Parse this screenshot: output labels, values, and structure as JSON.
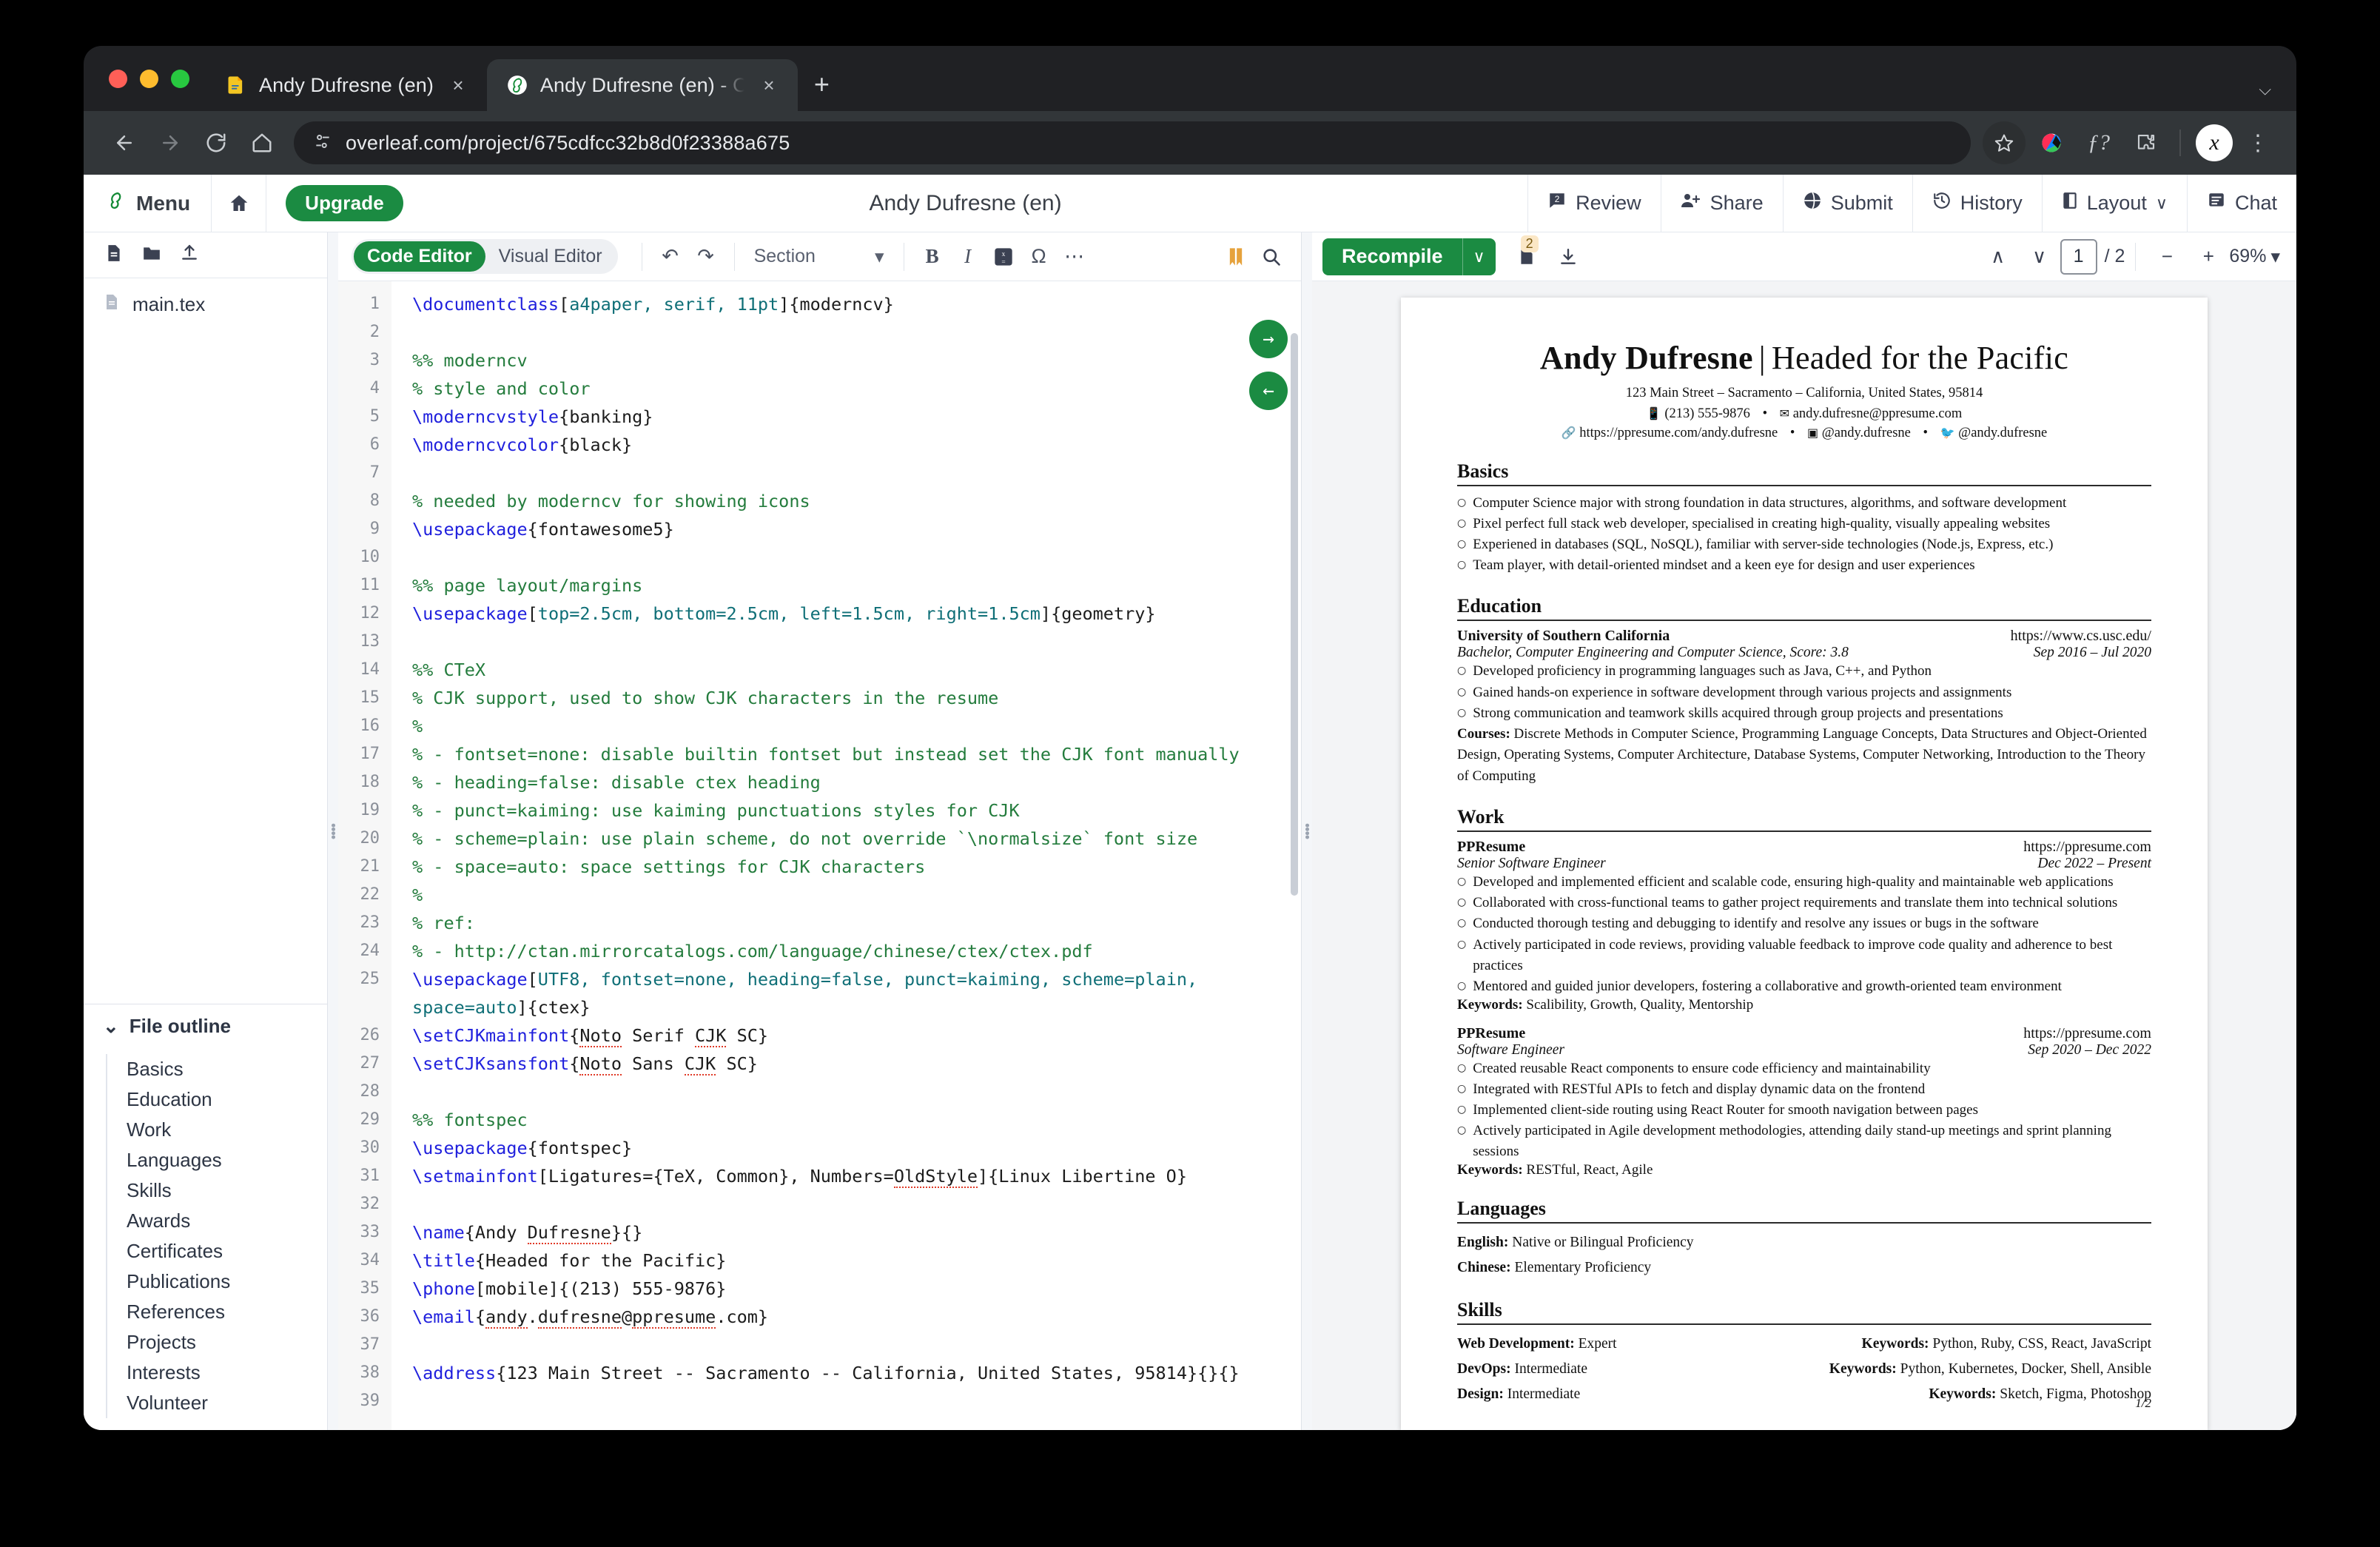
{
  "browser": {
    "tabs": [
      {
        "title": "Andy Dufresne (en)",
        "favicon": "pdf-document-icon",
        "active": false
      },
      {
        "title": "Andy Dufresne (en) - Online L",
        "favicon": "overleaf-icon",
        "active": true
      }
    ],
    "new_tab_label": "+",
    "tabstrip_menu": "⌵",
    "close_label": "×",
    "url": "overleaf.com/project/675cdfcc32b8d0f23388a675",
    "nav": {
      "back": "←",
      "forward": "→",
      "reload": "↻",
      "home": "⌂"
    },
    "extensions": [
      "star-icon",
      "color-palette-icon",
      "font-question-icon",
      "puzzle-extension-icon",
      "profile-avatar-icon"
    ],
    "menu_label": "⋮",
    "avatar_letter": "x"
  },
  "overleaf": {
    "menu_label": "Menu",
    "home_icon": "home-icon",
    "upgrade_label": "Upgrade",
    "project_title": "Andy Dufresne (en)",
    "actions": [
      {
        "label": "Review",
        "icon": "review-comment-icon"
      },
      {
        "label": "Share",
        "icon": "share-person-icon"
      },
      {
        "label": "Submit",
        "icon": "submit-globe-icon"
      },
      {
        "label": "History",
        "icon": "history-clock-icon"
      },
      {
        "label": "Layout",
        "icon": "layout-icon",
        "caret": "∨"
      },
      {
        "label": "Chat",
        "icon": "chat-icon"
      }
    ]
  },
  "file_panel": {
    "tools": [
      "new-file-icon",
      "new-folder-icon",
      "upload-icon"
    ],
    "files": [
      {
        "name": "main.tex",
        "icon": "tex-file-icon"
      }
    ],
    "outline_title": "File outline",
    "outline_caret": "⌄",
    "outline_items": [
      "Basics",
      "Education",
      "Work",
      "Languages",
      "Skills",
      "Awards",
      "Certificates",
      "Publications",
      "References",
      "Projects",
      "Interests",
      "Volunteer"
    ]
  },
  "editor_toolbar": {
    "code_editor": "Code Editor",
    "visual_editor": "Visual Editor",
    "undo": "↶",
    "redo": "↷",
    "section_select": "Section",
    "section_caret": "▾",
    "bold": "B",
    "italic": "I",
    "math": "math-icon",
    "symbol": "Ω",
    "more": "⋯",
    "bookmark": "bookmark-icon",
    "search": "search-icon"
  },
  "pdf_toolbar": {
    "recompile": "Recompile",
    "recompile_caret": "∨",
    "logs_badge": "2",
    "logs_icon": "logs-icon",
    "download_icon": "download-icon",
    "prev_icon": "∧",
    "next_icon": "∨",
    "page_current": "1",
    "page_total": "/ 2",
    "zoom_out": "−",
    "zoom_in": "+",
    "zoom_level": "69%",
    "zoom_caret": "▾"
  },
  "editor_nav": {
    "forward_arrow": "→",
    "back_arrow": "←"
  },
  "code_lines": [
    {
      "n": "1",
      "html": "<span class='k'>\\documentclass</span>[<span class='op'>a4paper, serif, 11pt</span>]{moderncv}"
    },
    {
      "n": "2",
      "html": ""
    },
    {
      "n": "3",
      "html": "<span class='cm'>%% moderncv</span>"
    },
    {
      "n": "4",
      "html": "<span class='cm'>% style and color</span>"
    },
    {
      "n": "5",
      "html": "<span class='k'>\\moderncvstyle</span>{banking}"
    },
    {
      "n": "6",
      "html": "<span class='k'>\\moderncvcolor</span>{black}"
    },
    {
      "n": "7",
      "html": ""
    },
    {
      "n": "8",
      "html": "<span class='cm'>% needed by moderncv for showing icons</span>"
    },
    {
      "n": "9",
      "html": "<span class='k'>\\usepackage</span>{fontawesome5}"
    },
    {
      "n": "10",
      "html": ""
    },
    {
      "n": "11",
      "html": "<span class='cm'>%% page layout/margins</span>"
    },
    {
      "n": "12",
      "html": "<span class='k'>\\usepackage</span>[<span class='op'>top=2.5cm, bottom=2.5cm, left=1.5cm, right=1.5cm</span>]{geometry}"
    },
    {
      "n": "13",
      "html": ""
    },
    {
      "n": "14",
      "html": "<span class='cm'>%% CTeX</span>"
    },
    {
      "n": "15",
      "html": "<span class='cm'>% CJK support, used to show CJK characters in the resume</span>"
    },
    {
      "n": "16",
      "html": "<span class='cm'>%</span>"
    },
    {
      "n": "17",
      "html": "<span class='cm'>% - fontset=none: disable builtin fontset but instead set the CJK font manually</span>"
    },
    {
      "n": "18",
      "html": "<span class='cm'>% - heading=false: disable ctex heading</span>"
    },
    {
      "n": "19",
      "html": "<span class='cm'>% - punct=kaiming: use kaiming punctuations styles for CJK</span>"
    },
    {
      "n": "20",
      "html": "<span class='cm'>% - scheme=plain: use plain scheme, do not override `\\normalsize` font size</span>"
    },
    {
      "n": "21",
      "html": "<span class='cm'>% - space=auto: space settings for CJK characters</span>"
    },
    {
      "n": "22",
      "html": "<span class='cm'>%</span>"
    },
    {
      "n": "23",
      "html": "<span class='cm'>% ref:</span>"
    },
    {
      "n": "24",
      "html": "<span class='cm'>% - http://ctan.mirrorcatalogs.com/language/chinese/ctex/ctex.pdf</span>"
    },
    {
      "n": "25",
      "html": "<span class='k'>\\usepackage</span>[<span class='op'>UTF8, fontset=none, heading=false, punct=kaiming, scheme=plain, space=auto</span>]{ctex}"
    },
    {
      "n": "26",
      "html": "<span class='k'>\\setCJKmainfont</span>{<span class='sp'>Noto</span> Serif <span class='sp'>CJK</span> SC}"
    },
    {
      "n": "27",
      "html": "<span class='k'>\\setCJKsansfont</span>{<span class='sp'>Noto</span> Sans <span class='sp'>CJK</span> SC}"
    },
    {
      "n": "28",
      "html": ""
    },
    {
      "n": "29",
      "html": "<span class='cm'>%% fontspec</span>"
    },
    {
      "n": "30",
      "html": "<span class='k'>\\usepackage</span>{fontspec}"
    },
    {
      "n": "31",
      "html": "<span class='k'>\\setmainfont</span>[Ligatures={TeX, Common}, Numbers=<span class='sp'>OldStyle</span>]{Linux Libertine O}"
    },
    {
      "n": "32",
      "html": ""
    },
    {
      "n": "33",
      "html": "<span class='k'>\\name</span>{Andy <span class='sp'>Dufresne</span>}{}"
    },
    {
      "n": "34",
      "html": "<span class='k'>\\title</span>{Headed for the Pacific}"
    },
    {
      "n": "35",
      "html": "<span class='k'>\\phone</span>[mobile]{(213) 555-9876}"
    },
    {
      "n": "36",
      "html": "<span class='k'>\\email</span>{<span class='sp'>andy</span>.<span class='sp'>dufresne</span>@<span class='sp'>ppresume</span>.com}"
    },
    {
      "n": "37",
      "html": ""
    },
    {
      "n": "38",
      "html": "<span class='k'>\\address</span>{123 Main Street -- Sacramento -- California, United States, 95814}{}{}"
    },
    {
      "n": "39",
      "html": ""
    }
  ],
  "resume": {
    "name": "Andy Dufresne",
    "divider": "|",
    "headline": "Headed for the Pacific",
    "address": "123 Main Street – Sacramento – California, United States, 95814",
    "phone": "(213) 555-9876",
    "email": "andy.dufresne@ppresume.com",
    "website": "https://ppresume.com/andy.dufresne",
    "social1": "@andy.dufresne",
    "social2": "@andy.dufresne",
    "bullet_sep": "•",
    "sections": {
      "basics": {
        "title": "Basics",
        "bullets": [
          "Computer Science major with strong foundation in data structures, algorithms, and software development",
          "Pixel perfect full stack web developer, specialised in creating high-quality, visually appealing websites",
          "Experiened in databases (SQL, NoSQL), familiar with server-side technologies (Node.js, Express, etc.)",
          "Team player, with detail-oriented mindset and a keen eye for design and user experiences"
        ]
      },
      "education": {
        "title": "Education",
        "entries": [
          {
            "org": "University of Southern California",
            "link": "https://www.cs.usc.edu/",
            "role": "Bachelor, Computer Engineering and Computer Science, Score: 3.8",
            "dates": "Sep 2016 – Jul 2020",
            "bullets": [
              "Developed proficiency in programming languages such as Java, C++, and Python",
              "Gained hands-on experience in software development through various projects and assignments",
              "Strong communication and teamwork skills acquired through group projects and presentations"
            ],
            "courses_label": "Courses:",
            "courses": "Discrete Methods in Computer Science, Programming Language Concepts, Data Structures and Object-Oriented Design, Operating Systems, Computer Architecture, Database Systems, Computer Networking, Introduction to the Theory of Computing"
          }
        ]
      },
      "work": {
        "title": "Work",
        "entries": [
          {
            "org": "PPResume",
            "link": "https://ppresume.com",
            "role": "Senior Software Engineer",
            "dates": "Dec 2022 – Present",
            "bullets": [
              "Developed and implemented efficient and scalable code, ensuring high-quality and maintainable web applications",
              "Collaborated with cross-functional teams to gather project requirements and translate them into technical solutions",
              "Conducted thorough testing and debugging to identify and resolve any issues or bugs in the software",
              "Actively participated in code reviews, providing valuable feedback to improve code quality and adherence to best practices",
              "Mentored and guided junior developers, fostering a collaborative and growth-oriented team environment"
            ],
            "keywords_label": "Keywords:",
            "keywords": "Scalibility, Growth, Quality, Mentorship"
          },
          {
            "org": "PPResume",
            "link": "https://ppresume.com",
            "role": "Software Engineer",
            "dates": "Sep 2020 – Dec 2022",
            "bullets": [
              "Created reusable React components to ensure code efficiency and maintainability",
              "Integrated with RESTful APIs to fetch and display dynamic data on the frontend",
              "Implemented client-side routing using React Router for smooth navigation between pages",
              "Actively participated in Agile development methodologies, attending daily stand-up meetings and sprint planning sessions"
            ],
            "keywords_label": "Keywords:",
            "keywords": "RESTful, React, Agile"
          }
        ]
      },
      "languages": {
        "title": "Languages",
        "items": [
          {
            "label": "English:",
            "value": "Native or Bilingual Proficiency"
          },
          {
            "label": "Chinese:",
            "value": "Elementary Proficiency"
          }
        ]
      },
      "skills": {
        "title": "Skills",
        "rows": [
          {
            "label": "Web Development:",
            "level": "Expert",
            "keywords_label": "Keywords:",
            "keywords": "Python, Ruby, CSS, React, JavaScript"
          },
          {
            "label": "DevOps:",
            "level": "Intermediate",
            "keywords_label": "Keywords:",
            "keywords": "Python, Kubernetes, Docker, Shell, Ansible"
          },
          {
            "label": "Design:",
            "level": "Intermediate",
            "keywords_label": "Keywords:",
            "keywords": "Sketch, Figma, Photoshop"
          }
        ]
      }
    },
    "page_number": "1/2"
  }
}
